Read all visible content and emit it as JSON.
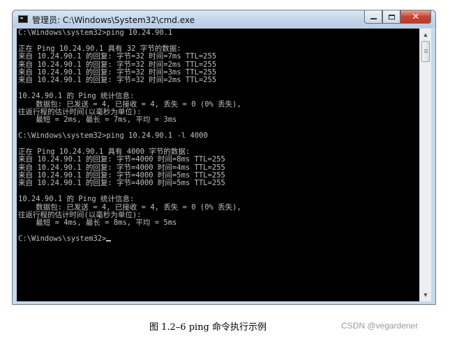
{
  "window": {
    "title": "管理员: C:\\Windows\\System32\\cmd.exe",
    "app_icon": "console-icon",
    "controls": {
      "minimize_icon": "minimize-icon",
      "maximize_icon": "maximize-icon",
      "close_label": "✕"
    }
  },
  "console": {
    "lines": [
      "C:\\Windows\\system32>ping 10.24.90.1",
      "",
      "正在 Ping 10.24.90.1 具有 32 字节的数据:",
      "来自 10.24.90.1 的回复: 字节=32 时间=7ms TTL=255",
      "来自 10.24.90.1 的回复: 字节=32 时间=2ms TTL=255",
      "来自 10.24.90.1 的回复: 字节=32 时间=3ms TTL=255",
      "来自 10.24.90.1 的回复: 字节=32 时间=2ms TTL=255",
      "",
      "10.24.90.1 的 Ping 统计信息:",
      "    数据包: 已发送 = 4, 已接收 = 4, 丢失 = 0 (0% 丢失),",
      "往返行程的估计时间(以毫秒为单位):",
      "    最短 = 2ms, 最长 = 7ms, 平均 = 3ms",
      "",
      "C:\\Windows\\system32>ping 10.24.90.1 -l 4000",
      "",
      "正在 Ping 10.24.90.1 具有 4000 字节的数据:",
      "来自 10.24.90.1 的回复: 字节=4000 时间=8ms TTL=255",
      "来自 10.24.90.1 的回复: 字节=4000 时间=4ms TTL=255",
      "来自 10.24.90.1 的回复: 字节=4000 时间=5ms TTL=255",
      "来自 10.24.90.1 的回复: 字节=4000 时间=5ms TTL=255",
      "",
      "10.24.90.1 的 Ping 统计信息:",
      "    数据包: 已发送 = 4, 已接收 = 4, 丢失 = 0 (0% 丢失),",
      "往返行程的估计时间(以毫秒为单位):",
      "    最短 = 4ms, 最长 = 8ms, 平均 = 5ms",
      "",
      "C:\\Windows\\system32>"
    ],
    "background": "#000000",
    "text_color": "#c0c0c0"
  },
  "scrollbar": {
    "up_arrow": "▲",
    "down_arrow": "▼"
  },
  "caption": "图 1.2–6 ping 命令执行示例",
  "watermark": "CSDN @vegardener"
}
